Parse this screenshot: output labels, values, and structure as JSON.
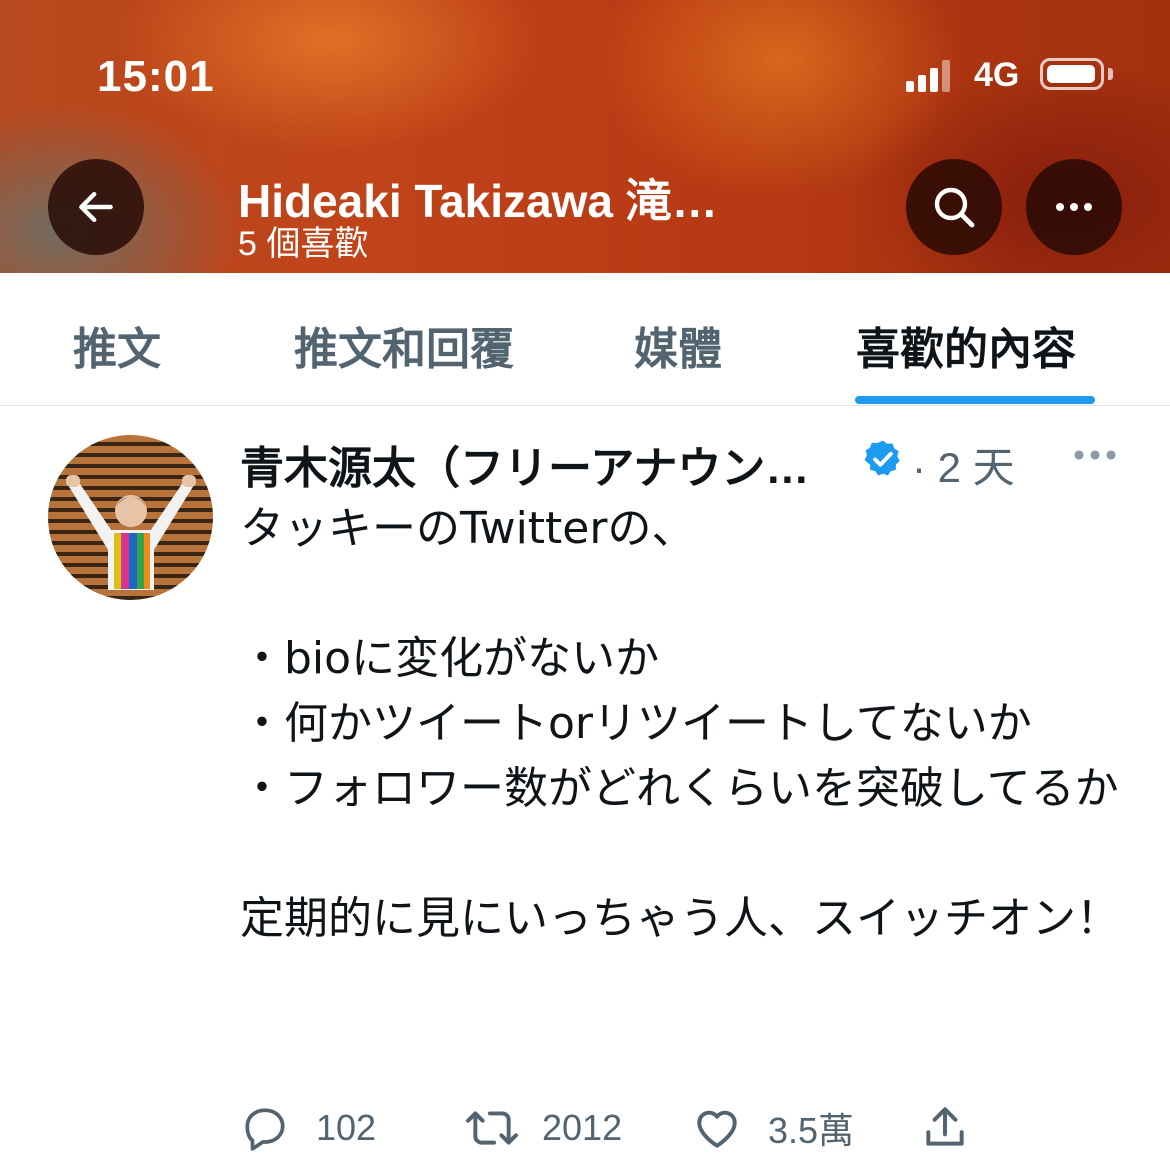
{
  "status_bar": {
    "time": "15:01",
    "network": "4G"
  },
  "header": {
    "title": "Hideaki Takizawa 滝…",
    "subtitle": "5 個喜歡"
  },
  "tabs": [
    {
      "label": "推文",
      "active": false
    },
    {
      "label": "推文和回覆",
      "active": false
    },
    {
      "label": "媒體",
      "active": false
    },
    {
      "label": "喜歡的內容",
      "active": true
    }
  ],
  "tweet": {
    "author_name": "青木源太（フリーアナウンサー）",
    "time": "· 2 天",
    "text": "タッキーのTwitterの、\n\n・bioに変化がないか\n・何かツイートorリツイートしてないか\n・フォロワー数がどれくらいを突破してるか\n\n定期的に見にいっちゃう人、スイッチオン！",
    "replies": "102",
    "retweets": "2012",
    "likes": "3.5萬"
  },
  "colors": {
    "accent": "#1d9bf0",
    "muted": "#536471",
    "text": "#0f1419"
  }
}
